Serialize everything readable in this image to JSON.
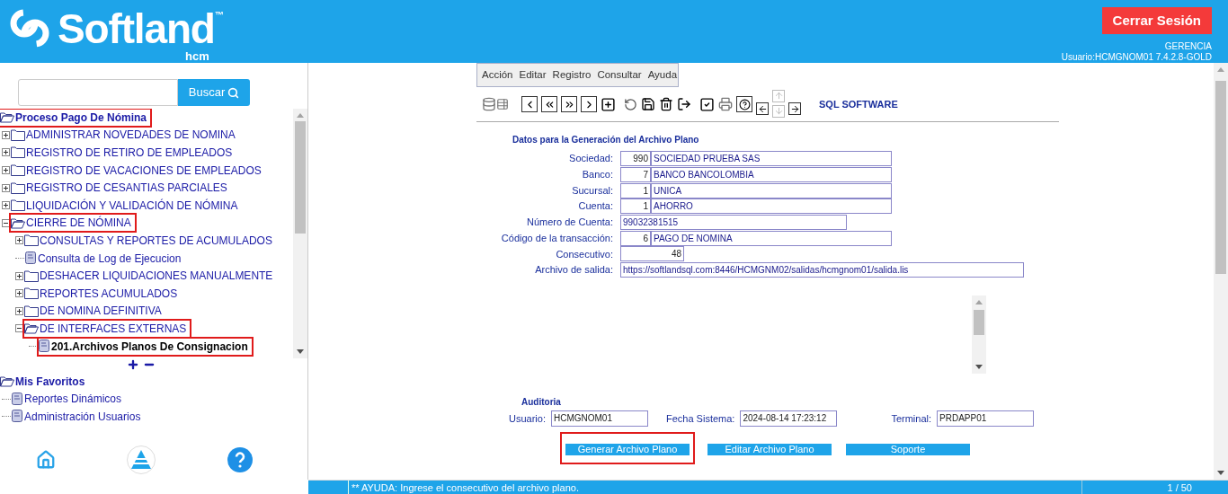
{
  "header": {
    "brand": "Softland",
    "trademark": "™",
    "product": "hcm",
    "logout_button": "Cerrar Sesión",
    "role": "GERENCIA",
    "user_info": "Usuario:HCMGNOM01 7.4.2.8-GOLD"
  },
  "sidebar": {
    "search": {
      "button": "Buscar"
    },
    "tree": [
      {
        "label": "Proceso Pago De Nómina",
        "kind": "root",
        "highlighted": true,
        "children": [
          {
            "label": "ADMINISTRAR NOVEDADES DE NOMINA",
            "kind": "folder",
            "expanded": false,
            "highlighted": false
          },
          {
            "label": "REGISTRO DE RETIRO DE EMPLEADOS",
            "kind": "folder",
            "expanded": false,
            "highlighted": false
          },
          {
            "label": "REGISTRO DE VACACIONES DE EMPLEADOS",
            "kind": "folder",
            "expanded": false,
            "highlighted": false
          },
          {
            "label": "REGISTRO DE CESANTIAS PARCIALES",
            "kind": "folder",
            "expanded": false,
            "highlighted": false
          },
          {
            "label": "LIQUIDACIÓN Y VALIDACIÓN DE NÓMINA",
            "kind": "folder",
            "expanded": false,
            "highlighted": false
          },
          {
            "label": "CIERRE DE NÓMINA",
            "kind": "folder",
            "expanded": true,
            "highlighted": true,
            "children": [
              {
                "label": "CONSULTAS Y REPORTES DE ACUMULADOS",
                "kind": "folder",
                "expanded": false,
                "highlighted": false
              },
              {
                "label": "Consulta de Log de Ejecucion",
                "kind": "doc",
                "highlighted": false
              },
              {
                "label": "DESHACER LIQUIDACIONES MANUALMENTE",
                "kind": "folder",
                "expanded": false,
                "highlighted": false
              },
              {
                "label": "REPORTES ACUMULADOS",
                "kind": "folder",
                "expanded": false,
                "highlighted": false
              },
              {
                "label": "DE NOMINA DEFINITIVA",
                "kind": "folder",
                "expanded": false,
                "highlighted": false
              },
              {
                "label": "DE INTERFACES EXTERNAS",
                "kind": "folder",
                "expanded": true,
                "highlighted": true,
                "children": [
                  {
                    "label": "201.Archivos Planos De Consignacion",
                    "kind": "doc",
                    "highlighted": true,
                    "selected": true
                  }
                ]
              }
            ]
          }
        ]
      }
    ],
    "favorites": [
      {
        "label": "Mis Favoritos",
        "kind": "root",
        "highlighted": false,
        "children": [
          {
            "label": "Reportes Dinámicos",
            "kind": "doc",
            "highlighted": false
          },
          {
            "label": "Administración Usuarios",
            "kind": "doc",
            "highlighted": false
          }
        ]
      }
    ]
  },
  "menu": [
    "Acción",
    "Editar",
    "Registro",
    "Consultar",
    "Ayuda"
  ],
  "toolbar": {
    "label": "SQL SOFTWARE"
  },
  "form": {
    "title": "Datos para la Generación del Archivo Plano",
    "fields": [
      {
        "label": "Sociedad:",
        "kind": "pair",
        "code": "990",
        "value": "SOCIEDAD  PRUEBA SAS"
      },
      {
        "label": "Banco:",
        "kind": "pair",
        "code": "7",
        "value": "BANCO BANCOLOMBIA"
      },
      {
        "label": "Sucursal:",
        "kind": "pair",
        "code": "1",
        "value": "UNICA"
      },
      {
        "label": "Cuenta:",
        "kind": "pair",
        "code": "1",
        "value": "AHORRO"
      },
      {
        "label": "Número de Cuenta:",
        "kind": "text",
        "value": "99032381515"
      },
      {
        "label": "Código de la transacción:",
        "kind": "pair",
        "code": "6",
        "value": "PAGO DE NOMINA"
      },
      {
        "label": "Consecutivo:",
        "kind": "number",
        "value": "48"
      },
      {
        "label": "Archivo de salida:",
        "kind": "url",
        "value": "https://softlandsql.com:8446/HCMGNM02/salidas/hcmgnom01/salida.lis"
      }
    ]
  },
  "audit": {
    "title": "Auditoria",
    "fields": [
      {
        "label": "Usuario:",
        "value": "HCMGNOM01"
      },
      {
        "label": "Fecha Sistema:",
        "value": "2024-08-14 17:23:12"
      },
      {
        "label": "Terminal:",
        "value": "PRDAPP01"
      }
    ]
  },
  "actions": [
    {
      "label": "Generar Archivo Plano",
      "highlighted": true
    },
    {
      "label": "Editar Archivo Plano",
      "highlighted": false
    },
    {
      "label": "Soporte",
      "highlighted": false
    }
  ],
  "status_bar": {
    "message": "** AYUDA: Ingrese el consecutivo del archivo plano.",
    "page": "1 / 50"
  }
}
